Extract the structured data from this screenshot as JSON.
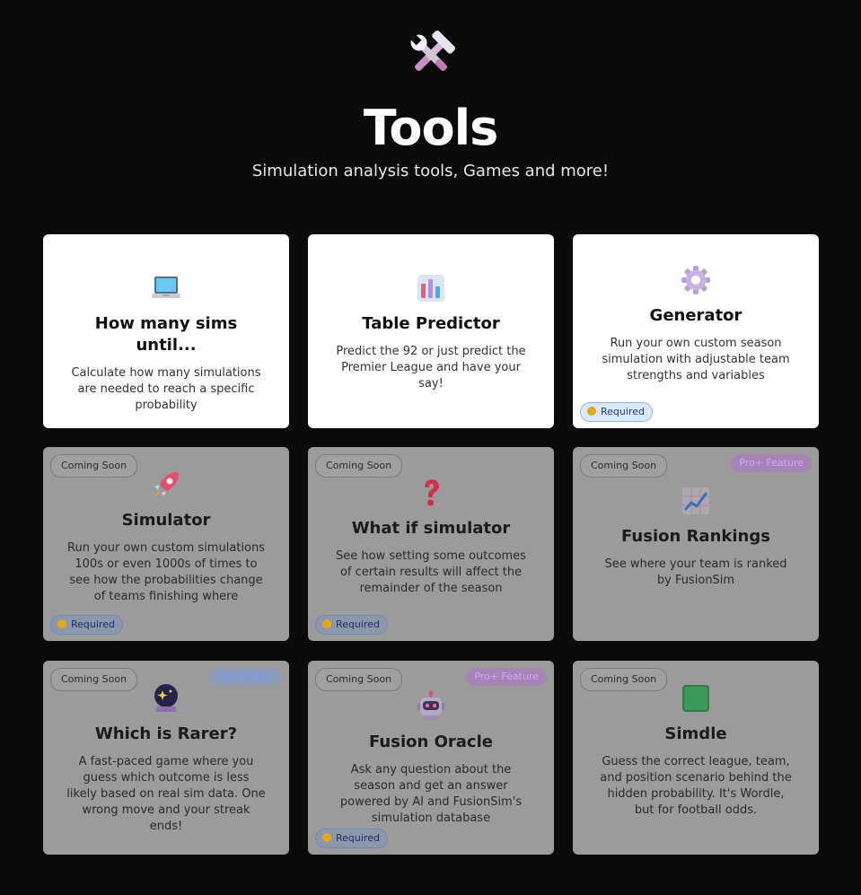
{
  "header": {
    "title": "Tools",
    "subtitle": "Simulation analysis tools, Games and more!",
    "icon": "hammer-wrench-icon"
  },
  "cards": [
    {
      "title": "How many sims until...",
      "description": "Calculate how many simulations are needed to reach a specific probability",
      "icon": "laptop-icon"
    },
    {
      "title": "Table Predictor",
      "description": "Predict the 92 or just predict the Premier League and have your say!",
      "icon": "bar-chart-icon"
    },
    {
      "title": "Generator",
      "description": "Run your own custom season simulation with adjustable team strengths and variables",
      "icon": "gear-icon",
      "required": "Required"
    },
    {
      "title": "Simulator",
      "description": "Run your own custom simulations 100s or even 1000s of times to see how the probabilities change of teams finishing where",
      "icon": "rocket-icon",
      "coming_soon": "Coming Soon",
      "required": "Required"
    },
    {
      "title": "What if simulator",
      "description": "See how setting some outcomes of certain results will affect the remainder of the season",
      "icon": "question-mark-icon",
      "coming_soon": "Coming Soon",
      "required": "Required"
    },
    {
      "title": "Fusion Rankings",
      "description": "See where your team is ranked by FusionSim",
      "icon": "trend-chart-icon",
      "coming_soon": "Coming Soon",
      "pro": "Pro+ Feature"
    },
    {
      "title": "Which is Rarer?",
      "description": "A fast-paced game where you guess which outcome is less likely based on real sim data. One wrong move and your streak ends!",
      "icon": "crystal-ball-icon",
      "coming_soon": "Coming Soon",
      "pro": "Pro Feature"
    },
    {
      "title": "Fusion Oracle",
      "description": "Ask any question about the season and get an answer powered by AI and FusionSim's simulation database",
      "icon": "robot-icon",
      "coming_soon": "Coming Soon",
      "pro": "Pro+ Feature",
      "required": "Required"
    },
    {
      "title": "Simdle",
      "description": "Guess the correct league, team, and position scenario behind the hidden probability. It's Wordle, but for football odds.",
      "icon": "green-square-icon",
      "coming_soon": "Coming Soon"
    }
  ]
}
